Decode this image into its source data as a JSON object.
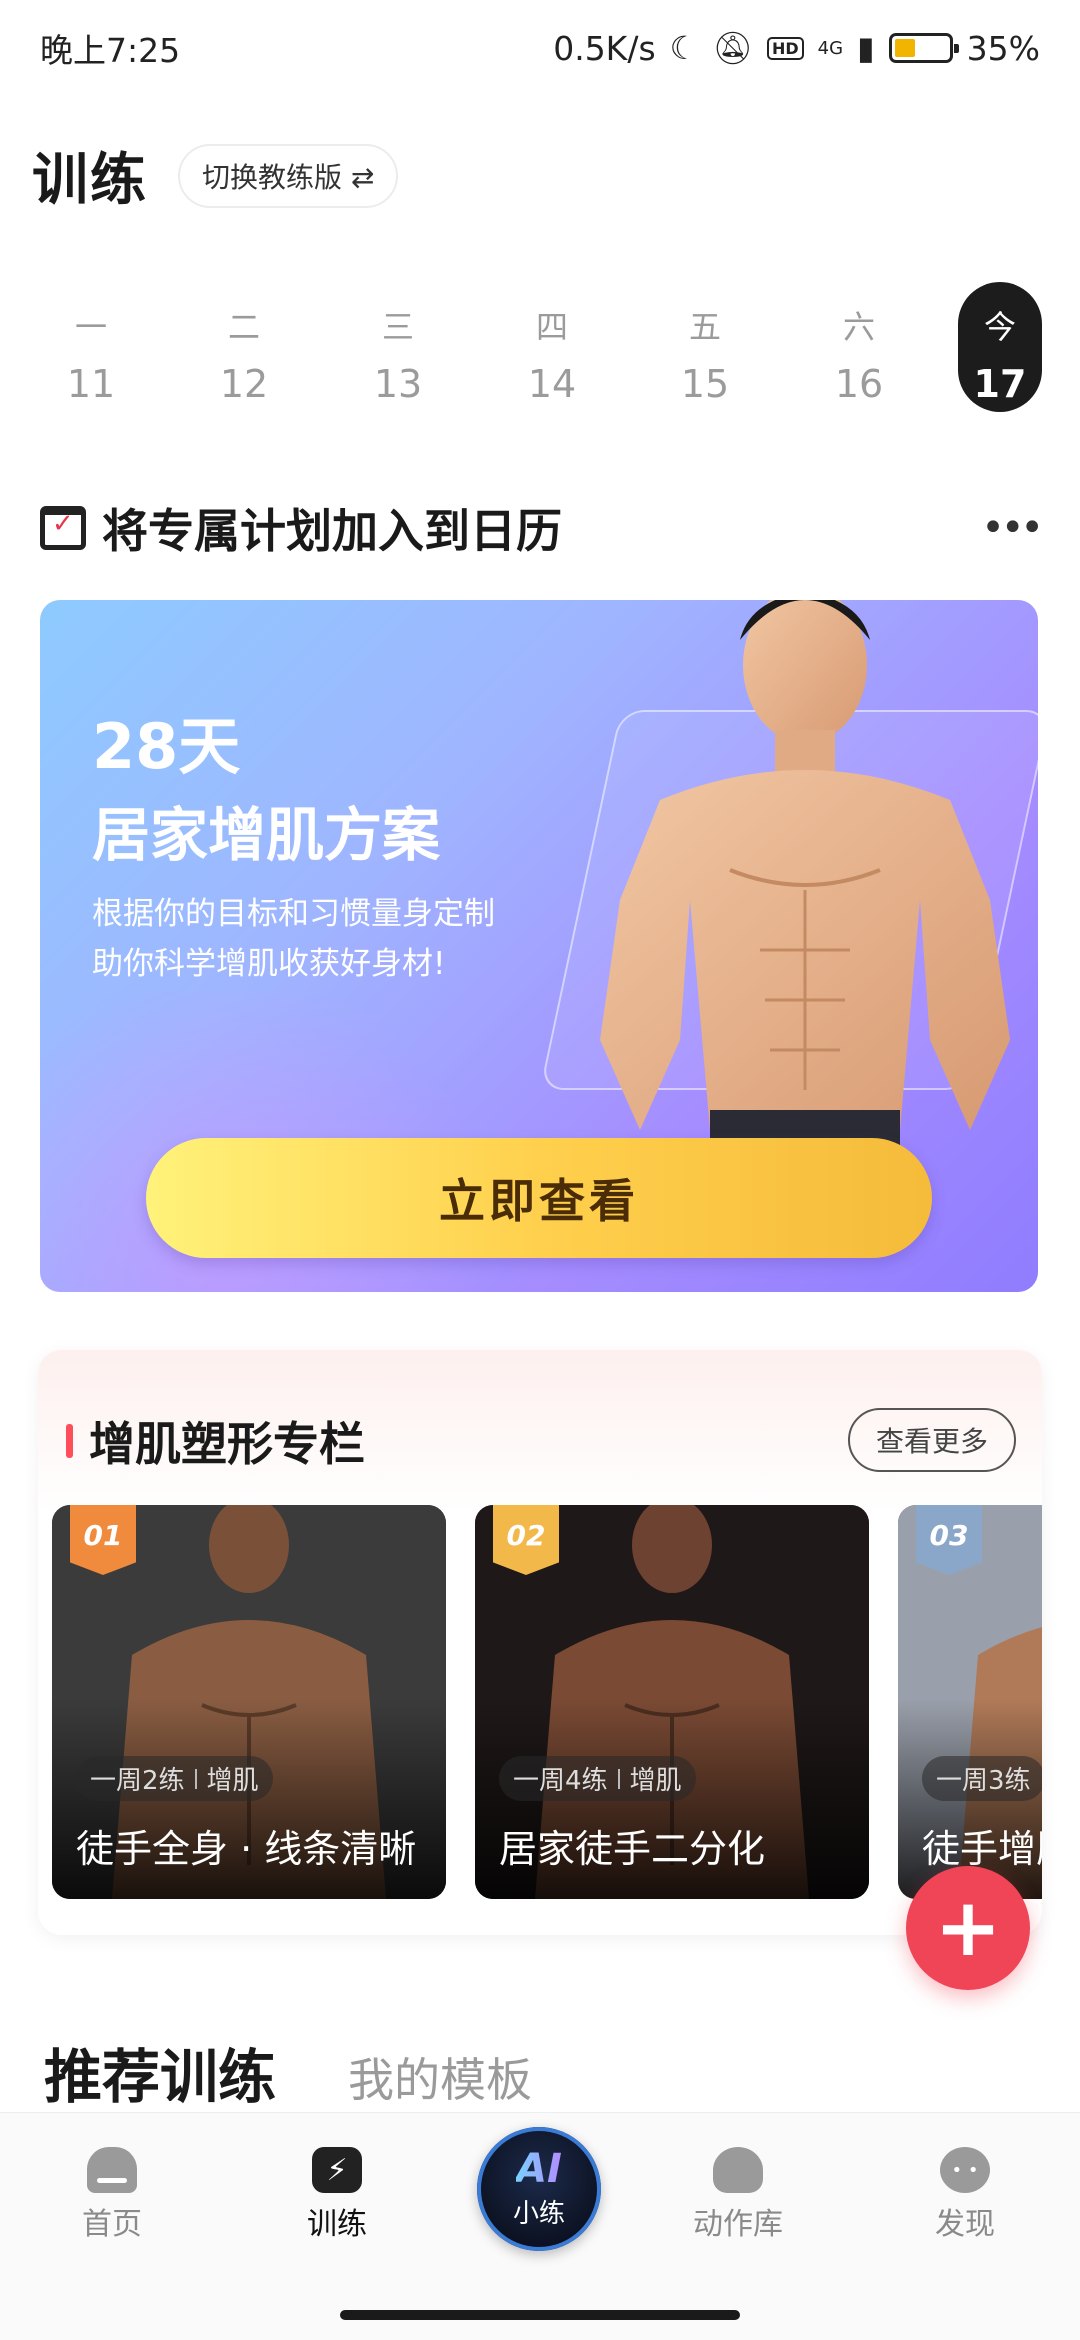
{
  "status_bar": {
    "time": "晚上7:25",
    "net_speed": "0.5K/s",
    "network": "4G",
    "hd": "HD",
    "battery_percent": "35%",
    "battery_level": 0.35
  },
  "header": {
    "title": "训练",
    "switch_label": "切换教练版 ⇄"
  },
  "week": [
    {
      "weekday": "一",
      "date": "11"
    },
    {
      "weekday": "二",
      "date": "12"
    },
    {
      "weekday": "三",
      "date": "13"
    },
    {
      "weekday": "四",
      "date": "14"
    },
    {
      "weekday": "五",
      "date": "15"
    },
    {
      "weekday": "六",
      "date": "16"
    },
    {
      "weekday": "今",
      "date": "17",
      "today": true
    }
  ],
  "plan": {
    "title": "将专属计划加入到日历",
    "more": "•••",
    "banner": {
      "days": "28天",
      "name": "居家增肌方案",
      "desc1": "根据你的目标和习惯量身定制",
      "desc2": "助你科学增肌收获好身材!",
      "cta": "立即查看"
    }
  },
  "column": {
    "title": "增肌塑形专栏",
    "see_more": "查看更多",
    "courses": [
      {
        "num": "01",
        "freq": "一周2练",
        "tag": "增肌",
        "name": "徒手全身 · 线条清晰",
        "badge_color": "#f08a3c"
      },
      {
        "num": "02",
        "freq": "一周4练",
        "tag": "增肌",
        "name": "居家徒手二分化",
        "badge_color": "#f2b84a"
      },
      {
        "num": "03",
        "freq": "一周3练",
        "tag": "",
        "name": "徒手增肌",
        "badge_color": "#8aa6c9"
      }
    ]
  },
  "fab": "+",
  "section_tabs": {
    "active": "推荐训练",
    "inactive": "我的模板"
  },
  "bottom_nav": {
    "home": "首页",
    "train": "训练",
    "ai": "小练",
    "ai_logo": "AI",
    "library": "动作库",
    "discover": "发现"
  }
}
